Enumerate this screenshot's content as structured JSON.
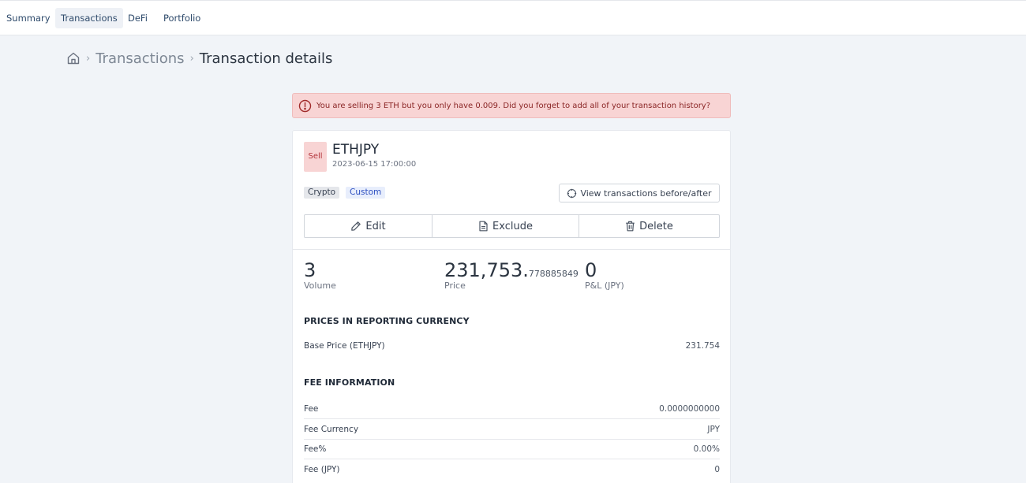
{
  "nav": {
    "tabs": [
      {
        "label": "Summary"
      },
      {
        "label": "Transactions"
      },
      {
        "label": "DeFi"
      },
      {
        "label": "Portfolio"
      }
    ],
    "active_tab": "Transactions"
  },
  "breadcrumb": {
    "home_icon": "home-icon",
    "parent": "Transactions",
    "current": "Transaction details"
  },
  "alert": {
    "icon": "alert-circle-icon",
    "text": "You are selling 3 ETH but you only have 0.009. Did you forget to add all of your transaction history?",
    "color": "#f8d4d4"
  },
  "transaction": {
    "side": "Sell",
    "pair": "ETHJPY",
    "datetime": "2023-06-15 17:00:00",
    "tags": [
      "Crypto",
      "Custom"
    ],
    "view_button_label": "View transactions before/after",
    "view_button_icon": "crosshair-icon"
  },
  "actions": {
    "edit": {
      "label": "Edit",
      "icon": "pencil-icon"
    },
    "exclude": {
      "label": "Exclude",
      "icon": "file-icon"
    },
    "delete": {
      "label": "Delete",
      "icon": "trash-icon"
    }
  },
  "stats": {
    "volume": {
      "value": "3",
      "label": "Volume"
    },
    "price": {
      "int": "231,753.",
      "dec": "778885849",
      "label": "Price"
    },
    "pnl": {
      "value": "0",
      "label": "P&L (JPY)"
    }
  },
  "reporting": {
    "title": "PRICES IN REPORTING CURRENCY",
    "rows": [
      {
        "label": "Base Price (ETHJPY)",
        "value": "231.754"
      }
    ]
  },
  "fees": {
    "title": "FEE INFORMATION",
    "rows": [
      {
        "label": "Fee",
        "value": "0.0000000000"
      },
      {
        "label": "Fee Currency",
        "value": "JPY"
      },
      {
        "label": "Fee%",
        "value": "0.00%"
      },
      {
        "label": "Fee (JPY)",
        "value": "0"
      }
    ]
  },
  "colors": {
    "sell_badge_bg": "#f8d4d4",
    "sell_badge_text": "#b2333a",
    "custom_tag_text": "#2d4fc1"
  }
}
